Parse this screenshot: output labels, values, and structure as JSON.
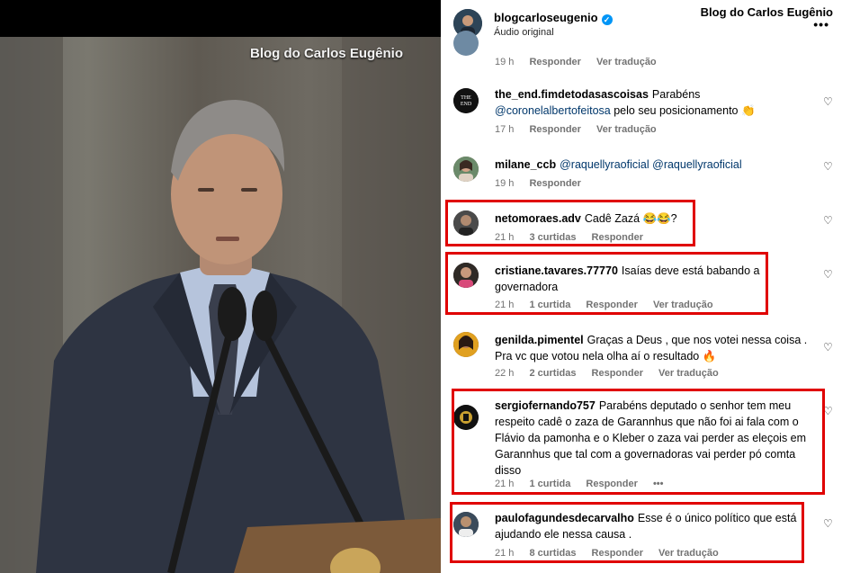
{
  "video": {
    "watermark": "Blog do Carlos Eugênio"
  },
  "header": {
    "username": "blogcarloseugenio",
    "subtitle": "Áudio original",
    "brand": "Blog do Carlos Eugênio",
    "more": "•••"
  },
  "comments": [
    {
      "user": "",
      "text": "",
      "time": "19 h",
      "likes": "",
      "reply": "Responder",
      "translate": "Ver tradução"
    },
    {
      "user": "the_end.fimdetodasascoisas",
      "text_before": "Parabéns ",
      "mention": "@coronelalbertofeitosa",
      "text_after": " pelo seu posicionamento 👏",
      "time": "17 h",
      "reply": "Responder",
      "translate": "Ver tradução"
    },
    {
      "user": "milane_ccb",
      "mention1": "@raquellyraoficial",
      "mention2": "@raquellyraoficial",
      "time": "19 h",
      "reply": "Responder"
    },
    {
      "user": "netomoraes.adv",
      "text": "Cadê Zazá 😂😂?",
      "time": "21 h",
      "likes": "3 curtidas",
      "reply": "Responder"
    },
    {
      "user": "cristiane.tavares.77770",
      "text": "Isaías deve está babando a governadora",
      "time": "21 h",
      "likes": "1 curtida",
      "reply": "Responder",
      "translate": "Ver tradução"
    },
    {
      "user": "genilda.pimentel",
      "text": "Graças a Deus , que nos votei nessa coisa . Pra vc que votou nela olha aí o resultado 🔥",
      "time": "22 h",
      "likes": "2 curtidas",
      "reply": "Responder",
      "translate": "Ver tradução"
    },
    {
      "user": "sergiofernando757",
      "text": "Parabéns deputado o senhor tem meu respeito cadê o zaza de Garannhus que não foi ai fala com o Flávio da pamonha e o Kleber o zaza vai perder as eleçois em Garannhus que tal com a governadoras vai perder pó comta disso",
      "time": "21 h",
      "likes": "1 curtida",
      "reply": "Responder",
      "dots": "•••"
    },
    {
      "user": "paulofagundesdecarvalho",
      "text": "Esse é o único político que está ajudando ele nessa causa .",
      "time": "21 h",
      "likes": "8 curtidas",
      "reply": "Responder",
      "translate": "Ver tradução"
    }
  ],
  "colors": {
    "highlight": "#e00000",
    "mention": "#00376b",
    "verified": "#0095f6",
    "meta": "#737373"
  },
  "icons": {
    "like": "heart-icon",
    "verified": "verified-badge-icon",
    "more": "more-options-icon"
  }
}
